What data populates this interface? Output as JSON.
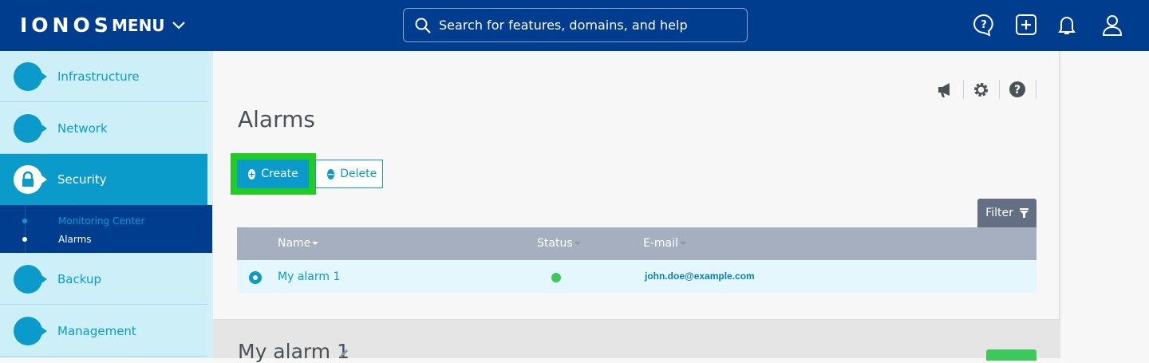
{
  "header": {
    "logo": "IONOS",
    "menu_label": "MENU",
    "search_placeholder": "Search for features, domains, and help",
    "icons": [
      "help-chat-icon",
      "add-icon",
      "bell-icon",
      "user-icon"
    ]
  },
  "sidebar": {
    "items": [
      {
        "label": "Infrastructure",
        "icon": "infrastructure-icon"
      },
      {
        "label": "Network",
        "icon": "globe-icon"
      },
      {
        "label": "Security",
        "icon": "lock-icon",
        "active": true
      },
      {
        "label": "Backup",
        "icon": "history-icon"
      },
      {
        "label": "Management",
        "icon": "clipboard-icon"
      }
    ],
    "subitems": [
      {
        "label": "Monitoring Center"
      },
      {
        "label": "Alarms",
        "active": true
      }
    ]
  },
  "main": {
    "title": "Alarms",
    "toolbar_icons": [
      "megaphone-icon",
      "gear-icon",
      "help-icon"
    ],
    "create_label": "Create",
    "delete_label": "Delete",
    "filter_label": "Filter",
    "columns": [
      "Name",
      "Status",
      "E-mail"
    ],
    "rows": [
      {
        "name": "My alarm 1",
        "status": "active",
        "status_color": "#3cc85a",
        "email": "john.doe@example.com",
        "selected": true
      }
    ]
  },
  "detail": {
    "title": "My alarm 1"
  },
  "colors": {
    "brand": "#003d8f",
    "accent": "#0b9bcb",
    "highlight": "#22cc22"
  }
}
